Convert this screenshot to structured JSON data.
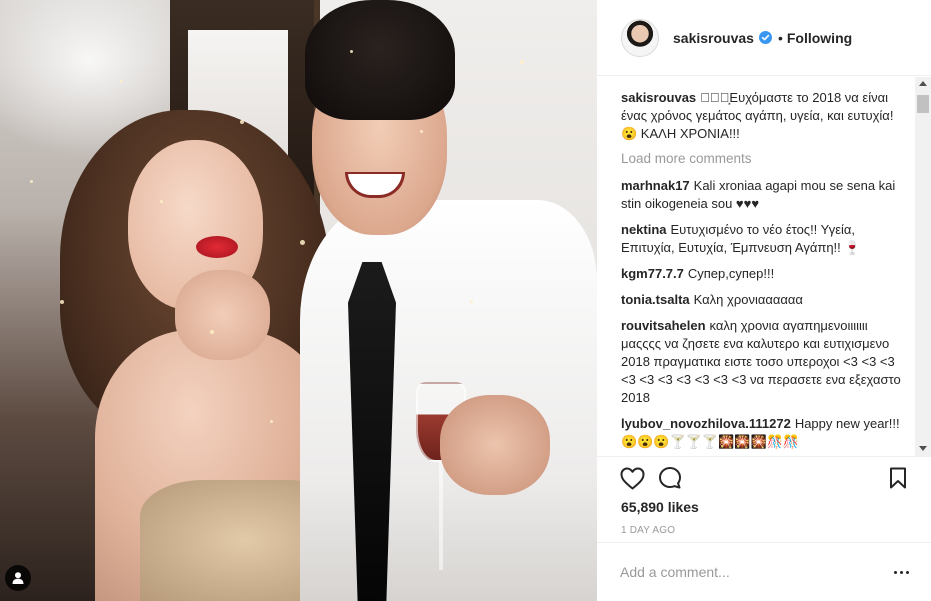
{
  "post": {
    "author": "sakisrouvas",
    "follow_status": "Following",
    "separator": "•",
    "icons": {
      "verified": "verified-badge-icon",
      "user_tag": "user-tag-icon"
    }
  },
  "comments": {
    "caption": {
      "user": "sakisrouvas",
      "text": "★⃞✦͙Ευχόμαστε το 2018 να είναι ένας χρόνος γεμάτος αγάπη, υγεία, και ευτυχία! 😮 ΚΑΛΗ ΧΡΟΝΙΑ!!!"
    },
    "load_more": "Load more comments",
    "items": [
      {
        "user": "marhnak17",
        "text": "Kali xroniaa agapi mou se sena kai stin oikogeneia sou ♥♥♥"
      },
      {
        "user": "nektina",
        "text": "Ευτυχισμένο το νέο έτος!! Υγεία, Επιτυχία, Ευτυχία, Έμπνευση Αγάπη!! 🍷"
      },
      {
        "user": "kgm77.7.7",
        "text": "Супер,супер!!!"
      },
      {
        "user": "tonia.tsalta",
        "text": "Καλη χρονιαααααα"
      },
      {
        "user": "rouvitsahelen",
        "text": "καλη χρονια αγαπημενοιιιιιιι μαςςςς να ζησετε ενα καλυτερο και ευτιχισμενο 2018 πραγματικα ειστε τοσο υπεροχοι <3 <3 <3 <3 <3 <3 <3 <3 <3 <3 να περασετε ενα εξεχαστο 2018"
      },
      {
        "user": "lyubov_novozhilova.111272",
        "text": "Happy new year!!! 😮😮😮🍸🍸🍸🎇🎇🎇🎊🎊"
      }
    ]
  },
  "actions": {
    "likes": "65,890 likes",
    "time": "1 DAY AGO",
    "icons": {
      "like": "heart-icon",
      "comment": "comment-icon",
      "save": "bookmark-icon",
      "more": "more-options-icon"
    }
  },
  "add_comment": {
    "placeholder": "Add a comment..."
  }
}
